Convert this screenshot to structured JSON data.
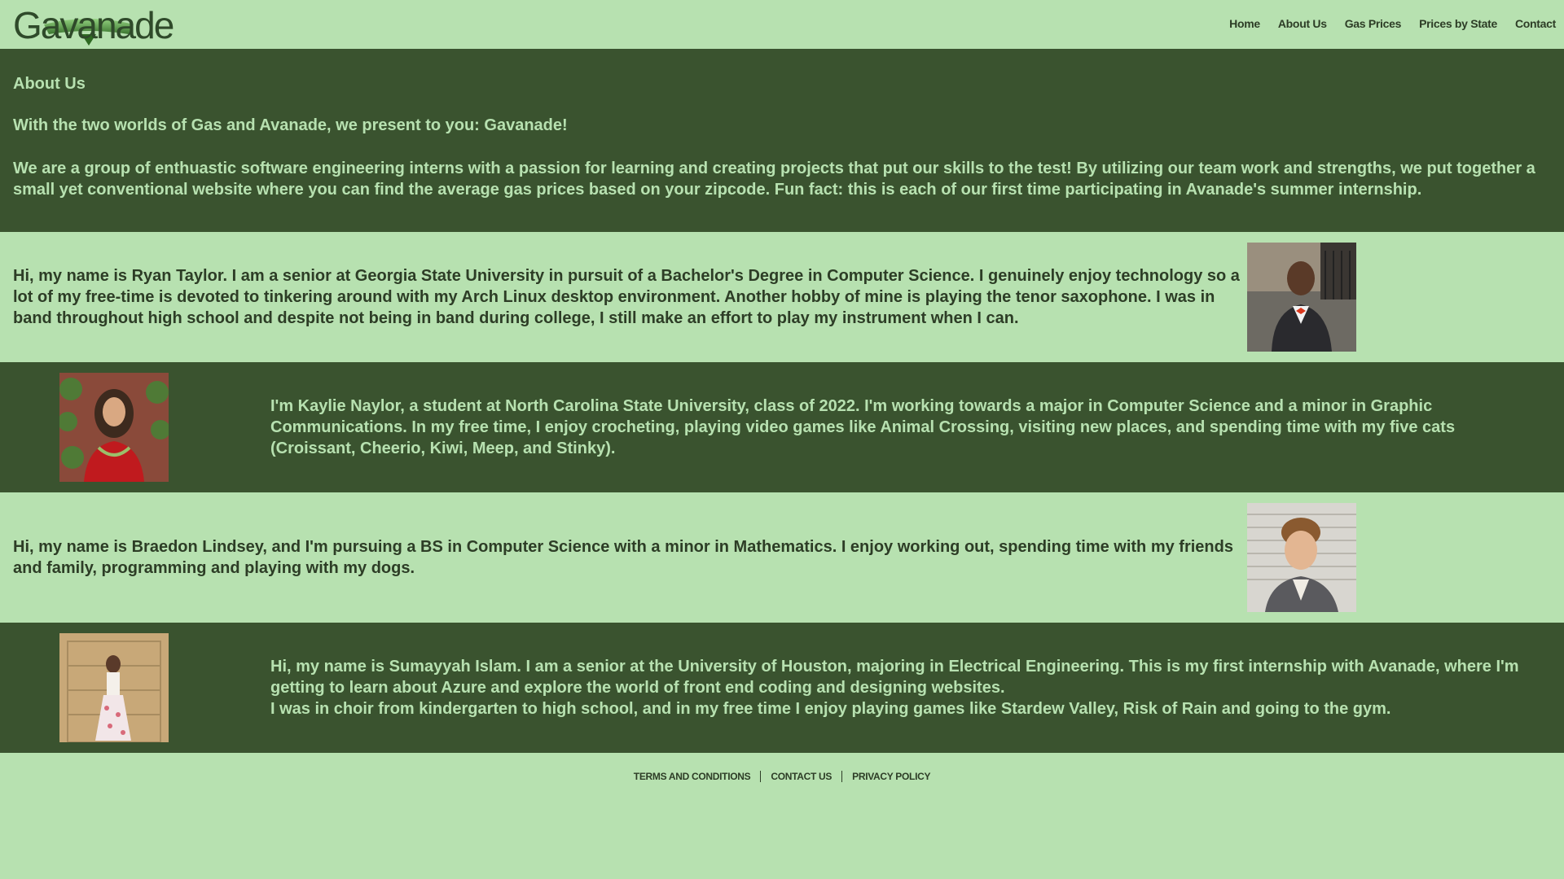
{
  "brand": {
    "logo_text": "Gavanade",
    "accent_color": "#3a532f",
    "light_color": "#b7e1b0"
  },
  "nav": {
    "items": [
      {
        "label": "Home"
      },
      {
        "label": "About Us"
      },
      {
        "label": "Gas Prices"
      },
      {
        "label": "Prices by State"
      },
      {
        "label": "Contact"
      }
    ]
  },
  "intro": {
    "title": "About Us",
    "tagline": "With the two worlds of Gas and Avanade, we present to you: Gavanade!",
    "description": "We are a group of enthuastic software engineering interns with a passion for learning and creating projects that put our skills to the test! By utilizing our team work and strengths, we put together a small yet conventional website where you can find the average gas prices based on your zipcode. Fun fact: this is each of our first time participating in Avanade's summer internship."
  },
  "members": [
    {
      "bio": "Hi, my name is Ryan Taylor. I am a senior at Georgia State University in pursuit of a Bachelor's Degree in Computer Science. I genuinely enjoy technology so a lot of my free-time is devoted to tinkering around with my Arch Linux desktop environment. Another hobby of mine is playing the tenor saxophone. I was in band throughout high school and despite not being in band during college, I still make an effort to play my instrument when I can.",
      "photo_icon": "person-photo-icon"
    },
    {
      "bio": "I'm Kaylie Naylor, a student at North Carolina State University, class of 2022. I'm working towards a major in Computer Science and a minor in Graphic Communications. In my free time, I enjoy crocheting, playing video games like Animal Crossing, visiting new places, and spending time with my five cats (Croissant, Cheerio, Kiwi, Meep, and Stinky).",
      "photo_icon": "person-photo-icon"
    },
    {
      "bio": "Hi, my name is Braedon Lindsey, and I'm pursuing a BS in Computer Science with a minor in Mathematics. I enjoy working out, spending time with my friends and family, programming and playing with my dogs.",
      "photo_icon": "person-photo-icon"
    },
    {
      "bio_line1": "Hi, my name is Sumayyah Islam. I am a senior at the University of Houston, majoring in Electrical Engineering. This is my first internship with Avanade, where I'm getting to learn about Azure and explore the world of front end coding and designing websites.",
      "bio_line2": "I was in choir from kindergarten to high school, and in my free time I enjoy playing games like Stardew Valley, Risk of Rain and going to the gym.",
      "photo_icon": "person-photo-icon"
    }
  ],
  "footer": {
    "links": [
      {
        "label": "TERMS AND CONDITIONS"
      },
      {
        "label": "CONTACT US"
      },
      {
        "label": "PRIVACY POLICY"
      }
    ]
  }
}
